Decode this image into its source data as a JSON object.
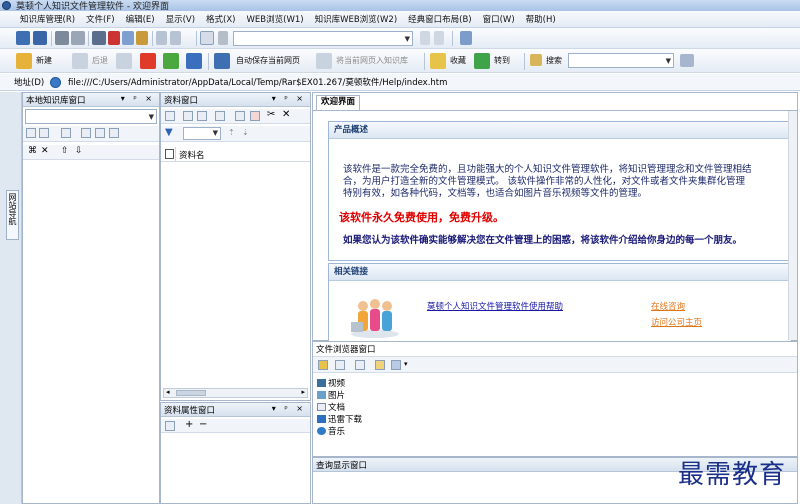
{
  "window": {
    "title": "莫顿个人知识文件管理软件 - 欢迎界面"
  },
  "menu": [
    "知识库管理(R)",
    "文件(F)",
    "编辑(E)",
    "显示(V)",
    "格式(X)",
    "WEB浏览(W1)",
    "知识库WEB浏览(W2)",
    "经典窗口布局(B)",
    "窗口(W)",
    "帮助(H)"
  ],
  "toolbar2": {
    "new_label": "新建",
    "back_label": "后退",
    "autosave_label": "自动保存当前网页",
    "add_page_label": "将当前网页入知识库",
    "favorite_label": "收藏",
    "goto_label": "转到",
    "search_label": "搜索"
  },
  "address": {
    "label": "地址(D)",
    "value": "file:///C:/Users/Administrator/AppData/Local/Temp/Rar$EX01.267/莫顿软件/Help/index.htm"
  },
  "sidebar": {
    "tab_label": "网站导航"
  },
  "panels": {
    "local_kb": {
      "title": "本地知识库窗口"
    },
    "data": {
      "title": "资料窗口",
      "column_header": "资料名"
    },
    "data_props": {
      "title": "资料属性窗口"
    },
    "file_browser": {
      "title": "文件浏览器窗口"
    },
    "query": {
      "title": "查询显示窗口"
    }
  },
  "document": {
    "tab_label": "欢迎界面",
    "overview_title": "产品概述",
    "overview_para_lines": [
      "该软件是一款完全免费的，且功能强大的个人知识文件管理软件，将知识管理理念和文件管理相结",
      "合，为用户打造全新的文件管理模式。 该软件操作非常的人性化，对文件或者文件夹集群化管理",
      "特别有效，如各种代码，文档等，也适合如图片音乐视频等文件的管理。"
    ],
    "free_text": "该软件永久免费使用，免费升级。",
    "recommend_text": "如果您认为该软件确实能够解决您在文件管理上的困惑，将该软件介绍给你身边的每一个朋友。",
    "links_title": "相关链接",
    "help_link": "莫顿个人知识文件管理软件使用帮助",
    "online_link": "在线咨询",
    "company_link": "访问公司主页"
  },
  "file_browser_items": [
    "视频",
    "图片",
    "文档",
    "迅雷下载",
    "音乐"
  ],
  "watermark": "最需教育",
  "colors": {
    "red_text": "#e00000",
    "link_blue": "#1a1aa8",
    "link_orange": "#e0761a",
    "header_blue": "#1d3f72"
  }
}
